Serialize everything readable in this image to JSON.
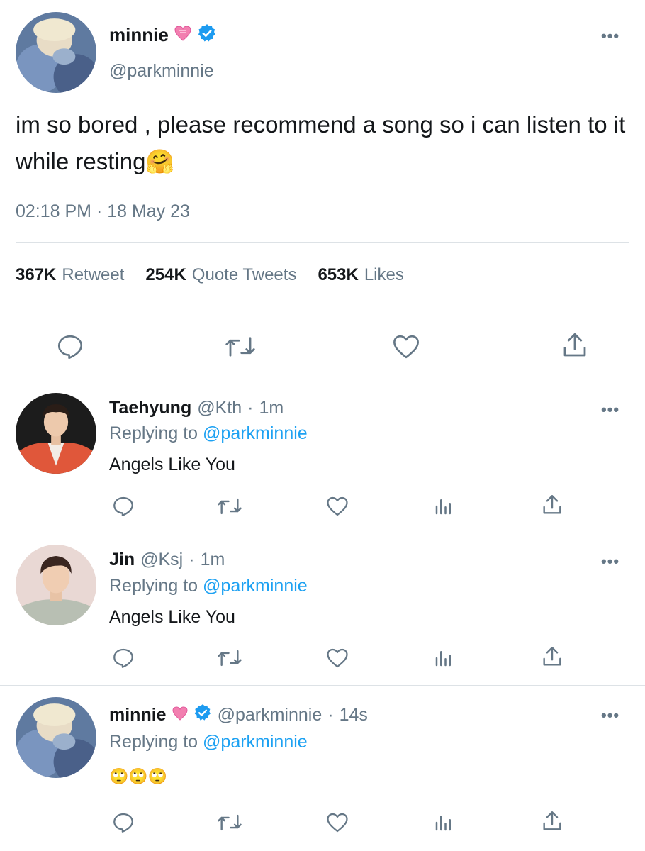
{
  "main_tweet": {
    "name": "minnie",
    "handle": "@parkminnie",
    "text": "im so bored , please recommend a song so i can listen to it while resting🤗",
    "timestamp": "02:18 PM · 18 May 23",
    "stats": [
      {
        "count": "367K",
        "label": "Retweet"
      },
      {
        "count": "254K",
        "label": "Quote Tweets"
      },
      {
        "count": "653K",
        "label": "Likes"
      }
    ]
  },
  "replies": [
    {
      "name": "Taehyung",
      "handle": "@Kth",
      "dot": "·",
      "time": "1m",
      "replying_prefix": "Replying to",
      "replying_to": "@parkminnie",
      "text": "Angels Like You"
    },
    {
      "name": "Jin",
      "handle": "@Ksj",
      "dot": "·",
      "time": "1m",
      "replying_prefix": "Replying to",
      "replying_to": "@parkminnie",
      "text": "Angels Like You"
    },
    {
      "name": "minnie",
      "handle": "@parkminnie",
      "dot": "·",
      "time": "14s",
      "replying_prefix": "Replying to",
      "replying_to": "@parkminnie",
      "text": "🙄🙄🙄"
    }
  ],
  "more_label": "•••",
  "colors": {
    "link": "#1da1f2",
    "muted": "#657786",
    "verified": "#1d9bf0",
    "divider": "#dde2e6"
  },
  "icons": [
    "reply-icon",
    "retweet-icon",
    "like-icon",
    "share-icon",
    "analytics-icon",
    "verified-icon",
    "heart-emoji",
    "more-icon"
  ]
}
